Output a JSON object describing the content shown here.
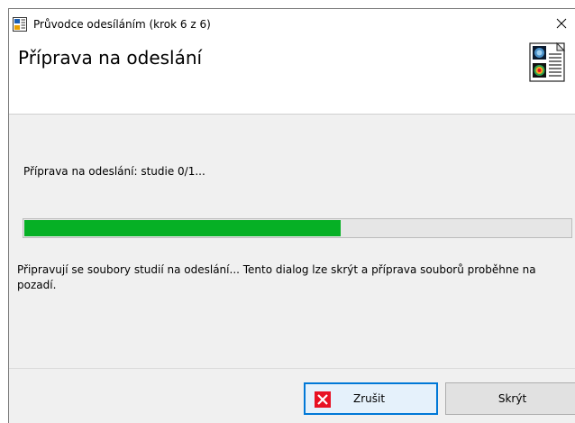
{
  "window": {
    "title": "Průvodce odesíláním (krok 6 z 6)",
    "close_glyph": "✕"
  },
  "header": {
    "title": "Příprava na odeslání",
    "logo_icon": "document-brain-scan-icon"
  },
  "status": {
    "text": "Příprava na odeslání: studie 0/1..."
  },
  "progress": {
    "percent": 58,
    "color": "#06b025"
  },
  "info": {
    "text": "Připravují se soubory studií na odeslání... Tento dialog lze skrýt a příprava souborů proběhne na pozadí."
  },
  "buttons": {
    "cancel_label": "Zrušit",
    "cancel_icon": "cancel-x-icon",
    "hide_label": "Skrýt"
  },
  "colors": {
    "accent": "#0078d7",
    "cancel_red": "#e81123"
  }
}
